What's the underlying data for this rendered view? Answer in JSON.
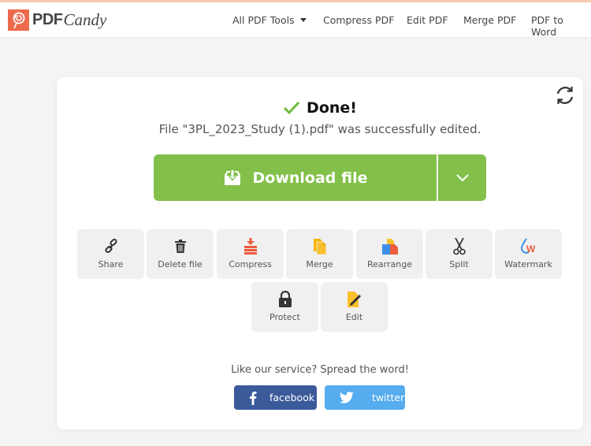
{
  "header": {
    "logo_pdf": "PDF",
    "logo_candy": "Candy",
    "nav": [
      {
        "label": "All PDF Tools",
        "has_caret": true
      },
      {
        "label": "Compress PDF"
      },
      {
        "label": "Edit PDF"
      },
      {
        "label": "Merge PDF"
      },
      {
        "label": "PDF to Word"
      }
    ]
  },
  "result": {
    "title": "Done!",
    "message": "File \"3PL_2023_Study (1).pdf\" was successfully edited.",
    "download_label": "Download file"
  },
  "tools": [
    {
      "label": "Share",
      "icon": "link-icon"
    },
    {
      "label": "Delete file",
      "icon": "trash-icon"
    },
    {
      "label": "Compress",
      "icon": "compress-icon"
    },
    {
      "label": "Merge",
      "icon": "merge-icon"
    },
    {
      "label": "Rearrange",
      "icon": "rearrange-icon"
    },
    {
      "label": "Split",
      "icon": "scissors-icon"
    },
    {
      "label": "Watermark",
      "icon": "watermark-icon"
    },
    {
      "label": "Protect",
      "icon": "lock-icon"
    },
    {
      "label": "Edit",
      "icon": "edit-icon"
    }
  ],
  "share": {
    "prompt": "Like our service? Spread the word!",
    "facebook_label": "facebook",
    "twitter_label": "twitter"
  },
  "colors": {
    "accent_green": "#82c04a",
    "brand_orange": "#ee6a4d",
    "facebook_blue": "#3b5a9a",
    "twitter_blue": "#55acee"
  }
}
